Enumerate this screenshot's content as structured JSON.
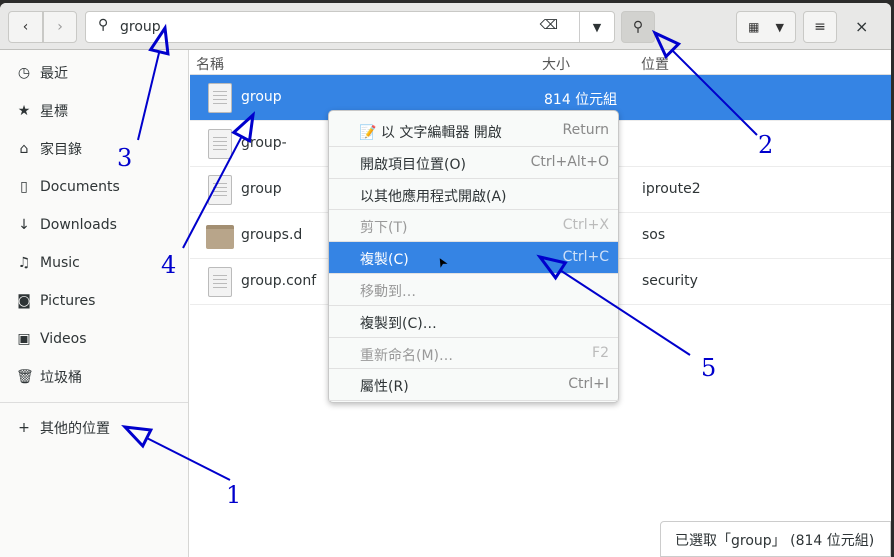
{
  "header": {
    "back_icon": "chevron-left",
    "forward_icon": "chevron-right",
    "search_value": "group",
    "clear_icon": "backspace-icon",
    "search_toggle_icon": "search-icon",
    "view_icon": "grid-icon",
    "menu_icon": "hamburger-icon",
    "close_label": "×"
  },
  "sidebar": {
    "items": [
      {
        "label": "最近",
        "icon": "◷"
      },
      {
        "label": "星標",
        "icon": "★"
      },
      {
        "label": "家目錄",
        "icon": "⌂"
      },
      {
        "label": "Documents",
        "icon": "▯"
      },
      {
        "label": "Downloads",
        "icon": "↓"
      },
      {
        "label": "Music",
        "icon": "♫"
      },
      {
        "label": "Pictures",
        "icon": "◙"
      },
      {
        "label": "Videos",
        "icon": "▣"
      },
      {
        "label": "垃圾桶",
        "icon": "🗑"
      }
    ],
    "other": {
      "label": "其他的位置",
      "icon": "+"
    }
  },
  "columns": {
    "name": "名稱",
    "size": "大小",
    "location": "位置"
  },
  "files": [
    {
      "name": "group",
      "size": "814 位元組",
      "location": "",
      "type": "file",
      "selected": true
    },
    {
      "name": "group-",
      "size": "",
      "location": "",
      "type": "file"
    },
    {
      "name": "group",
      "size": "",
      "location": "iproute2",
      "type": "file"
    },
    {
      "name": "groups.d",
      "size": "",
      "location": "sos",
      "type": "folder"
    },
    {
      "name": "group.conf",
      "size": "",
      "location": "security",
      "type": "file"
    }
  ],
  "context_menu": [
    {
      "label": "📝 以 文字編輯器 開啟",
      "shortcut": "Return"
    },
    {
      "label": "開啟項目位置(O)",
      "shortcut": "Ctrl+Alt+O"
    },
    {
      "label": "以其他應用程式開啟(A)",
      "shortcut": ""
    },
    {
      "label": "剪下(T)",
      "shortcut": "Ctrl+X",
      "disabled": true
    },
    {
      "label": "複製(C)",
      "shortcut": "Ctrl+C",
      "active": true
    },
    {
      "label": "移動到…",
      "shortcut": "",
      "disabled": true
    },
    {
      "label": "複製到(C)…",
      "shortcut": ""
    },
    {
      "label": "重新命名(M)…",
      "shortcut": "F2",
      "disabled": true
    },
    {
      "label": "屬性(R)",
      "shortcut": "Ctrl+I"
    }
  ],
  "status": "已選取「group」 (814 位元組)",
  "annotations": [
    "1",
    "2",
    "3",
    "4",
    "5"
  ],
  "colors": {
    "accent": "#3584e4",
    "annotation": "#0000cc"
  }
}
